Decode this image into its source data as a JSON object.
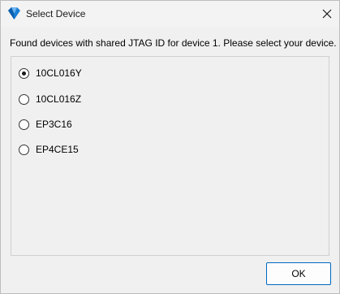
{
  "window": {
    "title": "Select Device",
    "app_icon": "quartus-logo-icon",
    "close_icon": "close-icon"
  },
  "instruction": "Found devices with shared JTAG ID for device 1. Please select your device.",
  "devices": [
    {
      "label": "10CL016Y",
      "selected": true
    },
    {
      "label": "10CL016Z",
      "selected": false
    },
    {
      "label": "EP3C16",
      "selected": false
    },
    {
      "label": "EP4CE15",
      "selected": false
    }
  ],
  "buttons": {
    "ok_label": "OK"
  },
  "colors": {
    "accent": "#0067c0",
    "logo": "#1a7fd6"
  }
}
